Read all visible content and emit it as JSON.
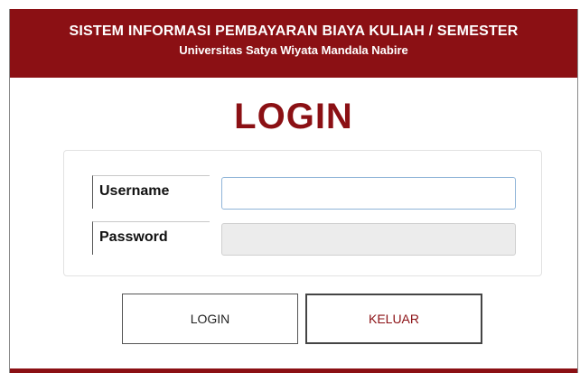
{
  "header": {
    "title": "SISTEM INFORMASI PEMBAYARAN BIAYA KULIAH / SEMESTER",
    "subtitle": "Universitas Satya Wiyata Mandala Nabire"
  },
  "login": {
    "heading": "LOGIN",
    "username_label": "Username",
    "username_value": "",
    "password_label": "Password",
    "password_value": ""
  },
  "buttons": {
    "login_label": "LOGIN",
    "keluar_label": "KELUAR"
  },
  "colors": {
    "brand": "#8b1014",
    "background": "#ffffff"
  }
}
